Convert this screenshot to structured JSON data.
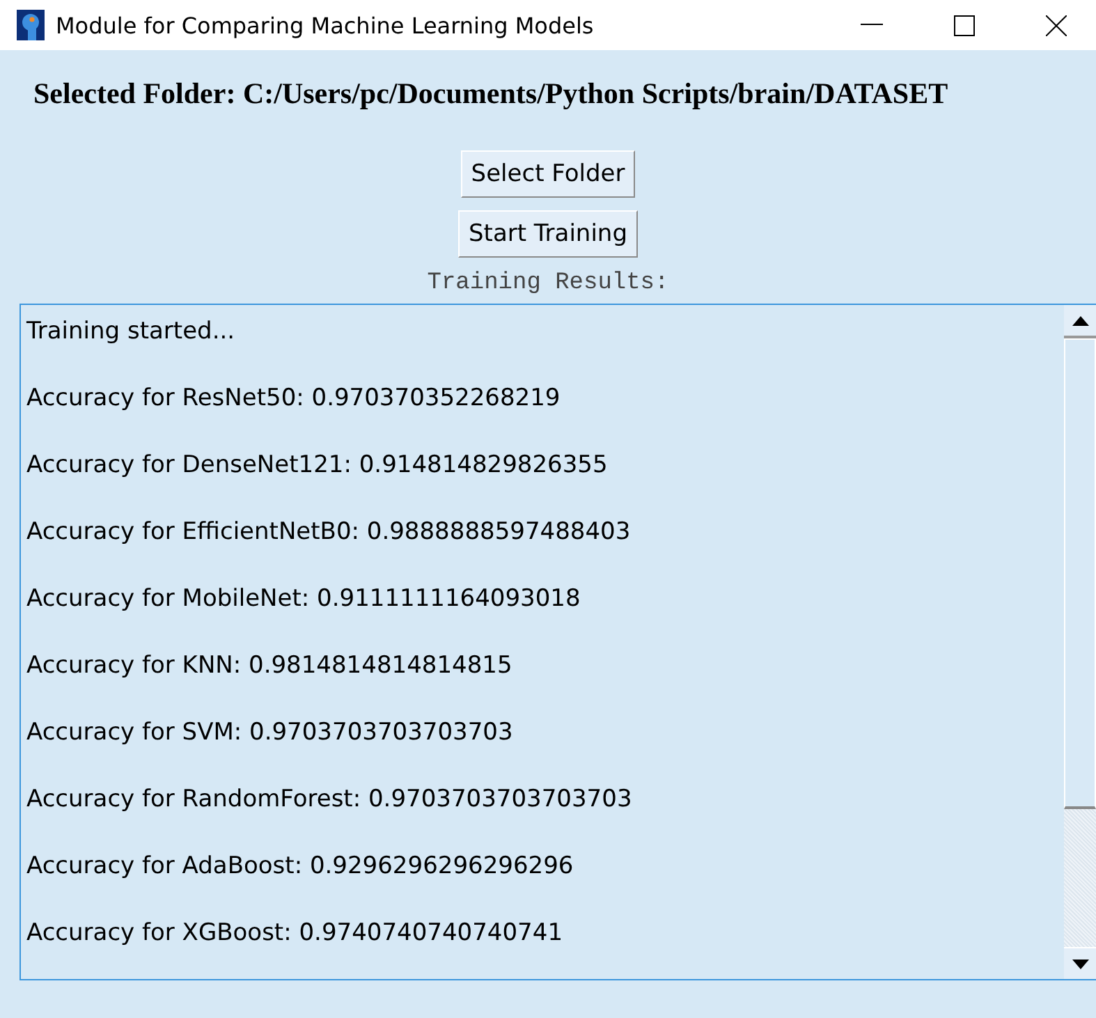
{
  "window": {
    "title": "Module for Comparing Machine Learning Models"
  },
  "selected_folder": "Selected Folder: C:/Users/pc/Documents/Python Scripts/brain/DATASET",
  "buttons": [
    "Select Folder",
    "Start Training"
  ],
  "results_label": "Training Results:",
  "results": [
    "Training started...",
    "Accuracy for ResNet50: 0.970370352268219",
    "Accuracy for DenseNet121: 0.914814829826355",
    "Accuracy for EfficientNetB0: 0.9888888597488403",
    "Accuracy for MobileNet: 0.9111111164093018",
    "Accuracy for KNN: 0.9814814814814815",
    "Accuracy for SVM: 0.9703703703703703",
    "Accuracy for RandomForest: 0.9703703703703703",
    "Accuracy for AdaBoost: 0.9296296296296296",
    "Accuracy for XGBoost: 0.9740740740740741"
  ]
}
